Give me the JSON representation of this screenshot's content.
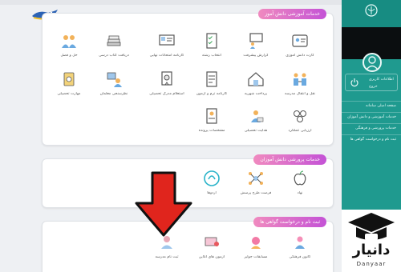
{
  "sidebar": {
    "banner_label": "اطلاعات کاربری",
    "logout_label": "خروج",
    "menu": [
      "صفحه اصلی سامانه",
      "خدمات آموزشی و دانش آموزان",
      "خدمات پرورشی و فرهنگی",
      "ثبت نام و درخواست گواهی ها"
    ]
  },
  "sections": {
    "education": {
      "title": "خدمات آموزشی دانش آموز",
      "tiles": [
        {
          "label": "کارت دانش آموزی",
          "icon": "id-card-icon"
        },
        {
          "label": "گزارش پیشرفت",
          "icon": "teacher-board-icon"
        },
        {
          "label": "انتخاب رشته",
          "icon": "checklist-icon"
        },
        {
          "label": "کارنامه امتحانات نهایی",
          "icon": "report-card-icon"
        },
        {
          "label": "دریافت کتاب درسی",
          "icon": "books-icon"
        },
        {
          "label": "حل و فصل",
          "icon": "meeting-icon"
        },
        {
          "label": "نقل و انتقال مدرسه",
          "icon": "transfer-icon"
        },
        {
          "label": "پرداخت شهریه",
          "icon": "house-payment-icon"
        },
        {
          "label": "کارنامه ترم و آزمون",
          "icon": "exam-sheet-icon"
        },
        {
          "label": "استعلام مدرک تحصیلی",
          "icon": "certificate-icon"
        },
        {
          "label": "نظرسنجی معلمان",
          "icon": "survey-icon"
        },
        {
          "label": "مهارت تحصیلی",
          "icon": "skill-book-icon"
        },
        {
          "label": "ارزیابی عملکرد",
          "icon": "evaluation-icon"
        },
        {
          "label": "هدایت تحصیلی",
          "icon": "guidance-icon"
        },
        {
          "label": "مشخصات پرونده",
          "icon": "profile-doc-icon"
        }
      ]
    },
    "culture": {
      "title": "خدمات پرورشی دانش آموزان",
      "tiles": [
        {
          "label": "نهاد",
          "icon": "apple-icon"
        },
        {
          "label": "فرصت طرح پرسش",
          "icon": "network-icon"
        },
        {
          "label": "اردوها",
          "icon": "camp-icon"
        }
      ]
    },
    "registration": {
      "title": "ثبت نام و درخواست گواهی ها",
      "tiles": [
        {
          "label": "کانون فرهنگی",
          "icon": "kids-icon"
        },
        {
          "label": "مسابقات جوایز",
          "icon": "prize-icon"
        },
        {
          "label": "آزمون های آنلاین",
          "icon": "online-exam-icon"
        },
        {
          "label": "ثبت نام مدرسه",
          "icon": "school-register-icon"
        }
      ]
    }
  },
  "watermark": {
    "brand": "دانیار",
    "latin": "Danyaar"
  },
  "colors": {
    "sidebar": "#1f9a8f",
    "tag_start": "#f08abf",
    "tag_end": "#c452d6",
    "arrow": "#e0251d"
  }
}
